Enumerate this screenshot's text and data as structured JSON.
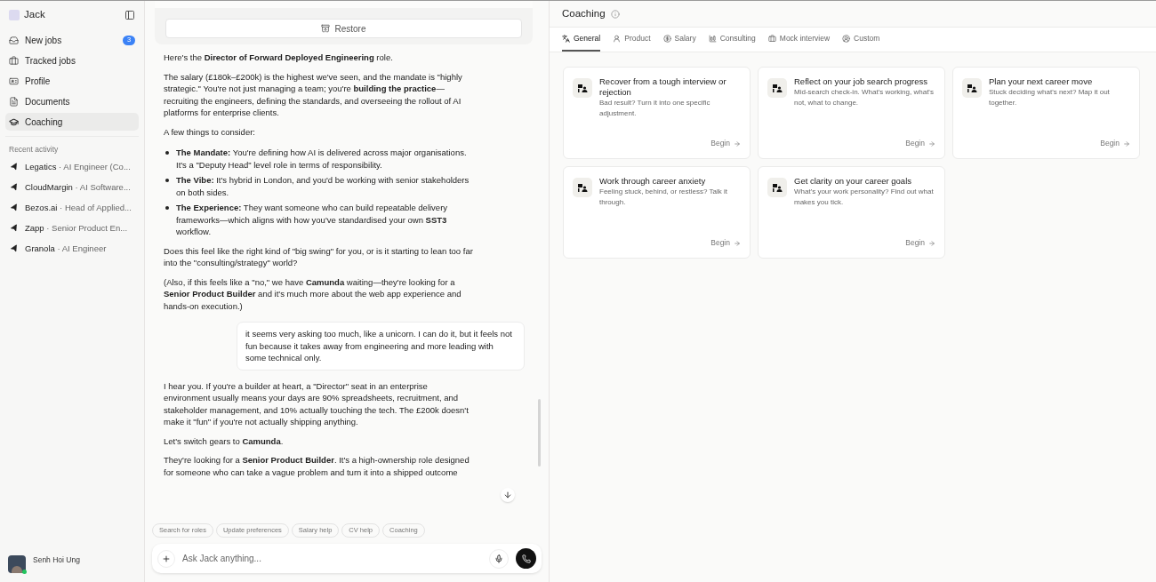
{
  "sidebar": {
    "app_name": "Jack",
    "nav": [
      {
        "label": "New jobs",
        "badge": "3",
        "selected": false
      },
      {
        "label": "Tracked jobs",
        "selected": false
      },
      {
        "label": "Profile",
        "selected": false
      },
      {
        "label": "Documents",
        "selected": false
      },
      {
        "label": "Coaching",
        "selected": true
      }
    ],
    "recent_heading": "Recent activity",
    "recent": [
      {
        "company": "Legatics",
        "role": "· AI Engineer (Co..."
      },
      {
        "company": "CloudMargin",
        "role": "· AI Software..."
      },
      {
        "company": "Bezos.ai",
        "role": "· Head of Applied..."
      },
      {
        "company": "Zapp",
        "role": "· Senior Product En..."
      },
      {
        "company": "Granola",
        "role": "· AI Engineer"
      }
    ],
    "user": {
      "name": "Senh Hoi Ung",
      "online": true
    }
  },
  "chat": {
    "restore_button": "Restore",
    "blocks": [
      {
        "kind": "paragraph",
        "text": "Here's the **Director of Forward Deployed Engineering** role."
      },
      {
        "kind": "paragraph",
        "text": "The salary (£180k–£200k) is the highest we've seen, and the mandate is \"highly strategic.\" You're not just managing a team; you're **building the practice**—recruiting the engineers, defining the standards, and overseeing the rollout of AI platforms for enterprise clients."
      },
      {
        "kind": "paragraph",
        "text": "A few things to consider:"
      },
      {
        "kind": "bullets",
        "items": [
          "**The Mandate:** You're defining how AI is delivered across major organisations. It's a \"Deputy Head\" level role in terms of responsibility.",
          "**The Vibe:** It's hybrid in London, and you'd be working with senior stakeholders on both sides.",
          "**The Experience:** They want someone who can build repeatable delivery frameworks—which aligns with how you've standardised your own **SST3** workflow."
        ]
      },
      {
        "kind": "paragraph",
        "text": "Does this feel like the right kind of \"big swing\" for you, or is it starting to lean too far into the \"consulting/strategy\" world?"
      },
      {
        "kind": "paragraph",
        "text": "(Also, if this feels like a \"no,\" we have **Camunda** waiting—they're looking for a **Senior Product Builder** and it's much more about the web app experience and hands-on execution.)"
      },
      {
        "kind": "user",
        "text": "it seems very asking too much, like a unicorn. I can do it, but it feels not fun because it takes away from engineering and more leading with some technical only."
      },
      {
        "kind": "paragraph",
        "text": "I hear you. If you're a builder at heart, a \"Director\" seat in an enterprise environment usually means your days are 90% spreadsheets, recruitment, and stakeholder management, and 10% actually touching the tech. The £200k doesn't make it \"fun\" if you're not actually shipping anything."
      },
      {
        "kind": "paragraph",
        "text": "Let's switch gears to **Camunda**."
      },
      {
        "kind": "paragraph",
        "text": "They're looking for a **Senior Product Builder**. It's a high-ownership role designed for someone who can take a vague problem and turn it into a shipped outcome"
      }
    ],
    "suggestions": [
      "Search for roles",
      "Update preferences",
      "Salary help",
      "CV help",
      "Coaching"
    ],
    "input": {
      "placeholder": "Ask Jack anything..."
    }
  },
  "coaching": {
    "title": "Coaching",
    "tabs": [
      {
        "label": "General",
        "selected": true
      },
      {
        "label": "Product",
        "selected": false
      },
      {
        "label": "Salary",
        "selected": false
      },
      {
        "label": "Consulting",
        "selected": false
      },
      {
        "label": "Mock interview",
        "selected": false
      },
      {
        "label": "Custom",
        "selected": false
      }
    ],
    "cards": [
      {
        "title": "Recover from a tough interview or rejection",
        "description": "Bad result? Turn it into one specific adjustment.",
        "action": "Begin"
      },
      {
        "title": "Reflect on your job search progress",
        "description": "Mid-search check-in. What's working, what's not, what to change.",
        "action": "Begin"
      },
      {
        "title": "Plan your next career move",
        "description": "Stuck deciding what's next? Map it out together.",
        "action": "Begin"
      },
      {
        "title": "Work through career anxiety",
        "description": "Feeling stuck, behind, or restless? Talk it through.",
        "action": "Begin"
      },
      {
        "title": "Get clarity on your career goals",
        "description": "What's your work personality? Find out what makes you tick.",
        "action": "Begin"
      }
    ]
  }
}
